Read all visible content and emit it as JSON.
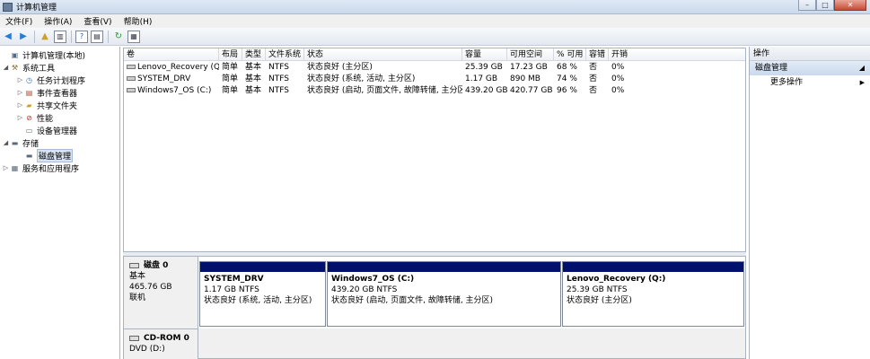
{
  "window": {
    "title": "计算机管理"
  },
  "menu": [
    {
      "label": "文件(F)"
    },
    {
      "label": "操作(A)"
    },
    {
      "label": "查看(V)"
    },
    {
      "label": "帮助(H)"
    }
  ],
  "tree": {
    "items": [
      {
        "label": "计算机管理(本地)",
        "icon": "computer-icon",
        "level": 0
      },
      {
        "label": "系统工具",
        "icon": "tools-icon",
        "level": 1
      },
      {
        "label": "任务计划程序",
        "icon": "clock-icon",
        "level": 2
      },
      {
        "label": "事件查看器",
        "icon": "event-viewer-icon",
        "level": 2
      },
      {
        "label": "共享文件夹",
        "icon": "shared-folder-icon",
        "level": 2
      },
      {
        "label": "性能",
        "icon": "performance-icon",
        "level": 2
      },
      {
        "label": "设备管理器",
        "icon": "device-manager-icon",
        "level": 2
      },
      {
        "label": "存储",
        "icon": "storage-icon",
        "level": 1
      },
      {
        "label": "磁盘管理",
        "icon": "disk-management-icon",
        "level": 2
      },
      {
        "label": "服务和应用程序",
        "icon": "services-icon",
        "level": 1
      }
    ]
  },
  "volumes": {
    "columns": [
      "卷",
      "布局",
      "类型",
      "文件系统",
      "状态",
      "容量",
      "可用空间",
      "% 可用",
      "容错",
      "开销"
    ],
    "rows": [
      [
        "Lenovo_Recovery (Q:)",
        "简单",
        "基本",
        "NTFS",
        "状态良好 (主分区)",
        "25.39 GB",
        "17.23 GB",
        "68 %",
        "否",
        "0%"
      ],
      [
        "SYSTEM_DRV",
        "简单",
        "基本",
        "NTFS",
        "状态良好 (系统, 活动, 主分区)",
        "1.17 GB",
        "890 MB",
        "74 %",
        "否",
        "0%"
      ],
      [
        "Windows7_OS (C:)",
        "简单",
        "基本",
        "NTFS",
        "状态良好 (启动, 页面文件, 故障转储, 主分区)",
        "439.20 GB",
        "420.77 GB",
        "96 %",
        "否",
        "0%"
      ]
    ]
  },
  "disk0": {
    "name": "磁盘 0",
    "type": "基本",
    "size": "465.76 GB",
    "status": "联机",
    "partitions": [
      {
        "name": "SYSTEM_DRV",
        "size": "1.17 GB NTFS",
        "status": "状态良好 (系统, 活动, 主分区)"
      },
      {
        "name": "Windows7_OS  (C:)",
        "size": "439.20 GB NTFS",
        "status": "状态良好 (启动, 页面文件, 故障转储, 主分区)"
      },
      {
        "name": "Lenovo_Recovery  (Q:)",
        "size": "25.39 GB NTFS",
        "status": "状态良好 (主分区)"
      }
    ]
  },
  "cdrom": {
    "name": "CD-ROM 0",
    "drive": "DVD (D:)"
  },
  "actions": {
    "header": "操作",
    "section": "磁盘管理",
    "more": "更多操作"
  },
  "colors": {
    "partition_band": "#00106e",
    "selection": "#d9e4f1"
  }
}
